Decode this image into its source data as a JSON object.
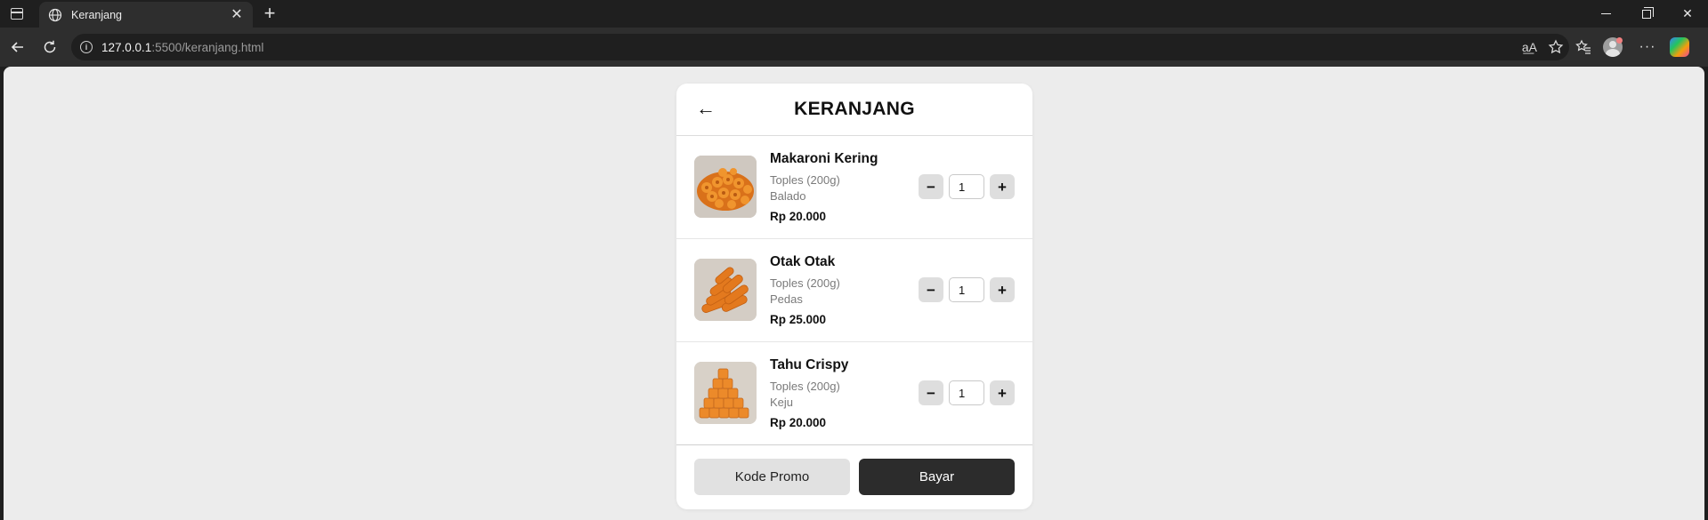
{
  "browser": {
    "tab_title": "Keranjang",
    "url_host": "127.0.0.1",
    "url_rest": ":5500/keranjang.html"
  },
  "page": {
    "title": "KERANJANG",
    "back_label": "←"
  },
  "cart": {
    "items": [
      {
        "name": "Makaroni Kering",
        "package": "Toples (200g)",
        "flavor": "Balado",
        "price": "Rp 20.000",
        "quantity": "1",
        "image_icon": "macaroni-image"
      },
      {
        "name": "Otak Otak",
        "package": "Toples (200g)",
        "flavor": "Pedas",
        "price": "Rp 25.000",
        "quantity": "1",
        "image_icon": "otak-otak-image"
      },
      {
        "name": "Tahu Crispy",
        "package": "Toples (200g)",
        "flavor": "Keju",
        "price": "Rp 20.000",
        "quantity": "1",
        "image_icon": "tahu-crispy-image"
      }
    ],
    "minus_label": "−",
    "plus_label": "+"
  },
  "footer": {
    "promo_label": "Kode Promo",
    "pay_label": "Bayar"
  },
  "colors": {
    "page_bg": "#ececec",
    "card_bg": "#ffffff",
    "primary_button": "#2c2c2c",
    "secondary_button": "#e1e1e1",
    "food_orange": "#e8791c"
  }
}
